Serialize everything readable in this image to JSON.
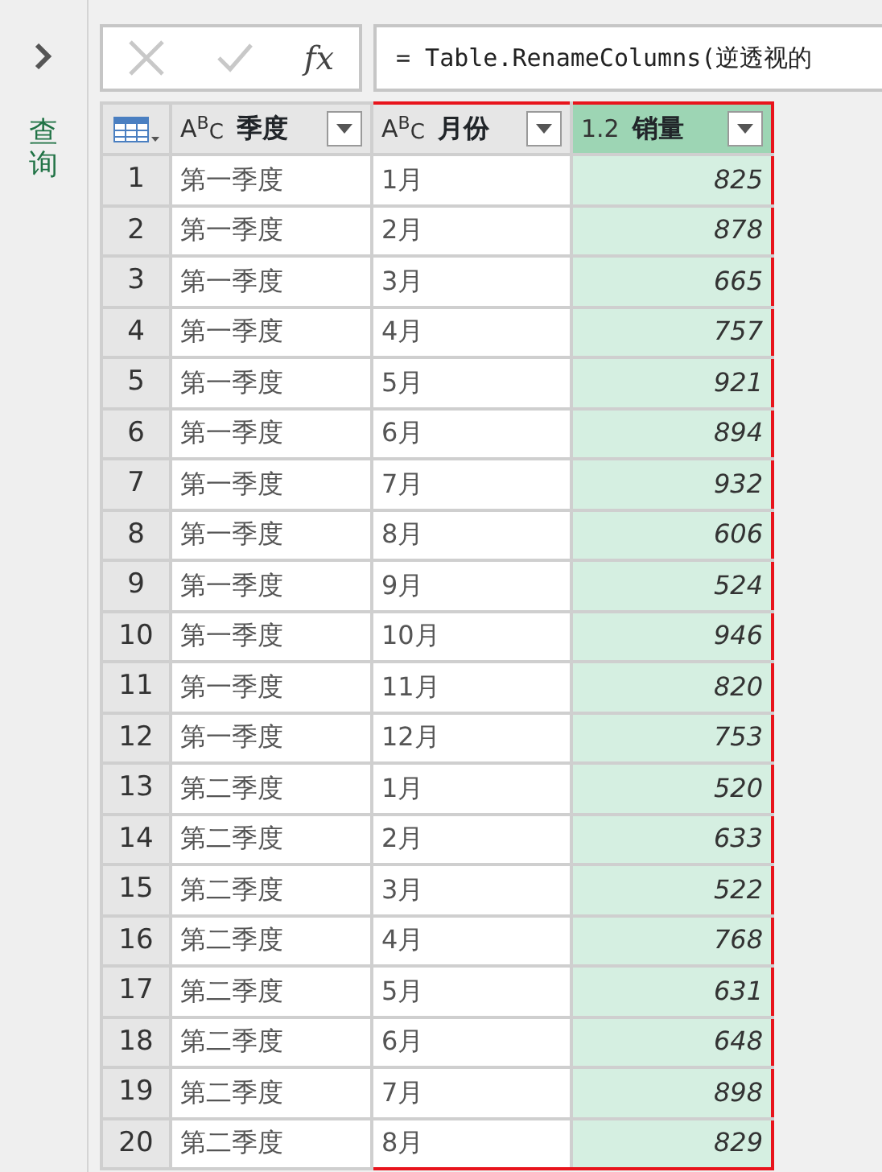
{
  "sidebar": {
    "label": "查询"
  },
  "formula_bar": {
    "cancel": {
      "disabled": true
    },
    "confirm": {
      "disabled": true
    },
    "fx": "fx",
    "formula": "= Table.RenameColumns(逆透视的"
  },
  "table": {
    "columns": [
      {
        "type_label": "A$^{B}$$_{C}$",
        "title": "季度",
        "selected": false,
        "outlined": false,
        "kind": "text"
      },
      {
        "type_label": "A$^{B}$$_{C}$",
        "title": "月份",
        "selected": false,
        "outlined": true,
        "kind": "text"
      },
      {
        "type_label": "1.2",
        "title": "销量",
        "selected": true,
        "outlined": true,
        "kind": "number"
      }
    ],
    "rows": [
      {
        "index": "1",
        "cells": [
          "第一季度",
          "1月",
          "825"
        ]
      },
      {
        "index": "2",
        "cells": [
          "第一季度",
          "2月",
          "878"
        ]
      },
      {
        "index": "3",
        "cells": [
          "第一季度",
          "3月",
          "665"
        ]
      },
      {
        "index": "4",
        "cells": [
          "第一季度",
          "4月",
          "757"
        ]
      },
      {
        "index": "5",
        "cells": [
          "第一季度",
          "5月",
          "921"
        ]
      },
      {
        "index": "6",
        "cells": [
          "第一季度",
          "6月",
          "894"
        ]
      },
      {
        "index": "7",
        "cells": [
          "第一季度",
          "7月",
          "932"
        ]
      },
      {
        "index": "8",
        "cells": [
          "第一季度",
          "8月",
          "606"
        ]
      },
      {
        "index": "9",
        "cells": [
          "第一季度",
          "9月",
          "524"
        ]
      },
      {
        "index": "10",
        "cells": [
          "第一季度",
          "10月",
          "946"
        ]
      },
      {
        "index": "11",
        "cells": [
          "第一季度",
          "11月",
          "820"
        ]
      },
      {
        "index": "12",
        "cells": [
          "第一季度",
          "12月",
          "753"
        ]
      },
      {
        "index": "13",
        "cells": [
          "第二季度",
          "1月",
          "520"
        ]
      },
      {
        "index": "14",
        "cells": [
          "第二季度",
          "2月",
          "633"
        ]
      },
      {
        "index": "15",
        "cells": [
          "第二季度",
          "3月",
          "522"
        ]
      },
      {
        "index": "16",
        "cells": [
          "第二季度",
          "4月",
          "768"
        ]
      },
      {
        "index": "17",
        "cells": [
          "第二季度",
          "5月",
          "631"
        ]
      },
      {
        "index": "18",
        "cells": [
          "第二季度",
          "6月",
          "648"
        ]
      },
      {
        "index": "19",
        "cells": [
          "第二季度",
          "7月",
          "898"
        ]
      },
      {
        "index": "20",
        "cells": [
          "第二季度",
          "8月",
          "829"
        ]
      }
    ]
  }
}
